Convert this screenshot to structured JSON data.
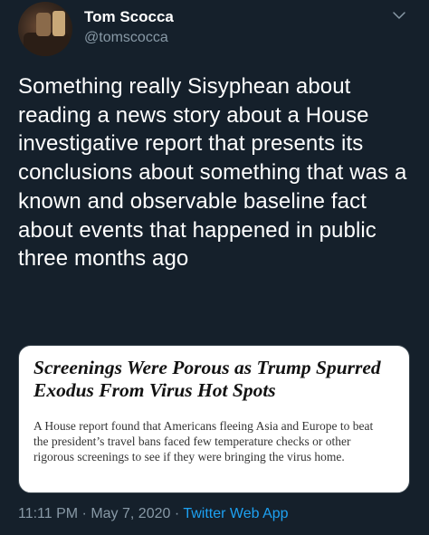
{
  "author": {
    "name": "Tom Scocca",
    "handle": "@tomscocca"
  },
  "tweet": {
    "text": "Something really Sisyphean about reading a news story about a House investigative report that presents its conclusions about something that was a known and observable baseline fact about events that happened in public three months ago"
  },
  "card": {
    "headline": "Screenings Were Porous as Trump Spurred Exodus From Virus Hot Spots",
    "summary": "A House report found that Americans fleeing Asia and Europe to beat the president’s travel bans faced few temperature checks or other rigorous screenings to see if they were bringing the virus home."
  },
  "meta": {
    "time": "11:11 PM",
    "separator1": " · ",
    "date": "May 7, 2020",
    "separator2": " · ",
    "app": "Twitter Web App"
  },
  "icons": {
    "menu": "chevron-down-icon"
  },
  "colors": {
    "background": "#15202b",
    "secondary_text": "#8899a6",
    "link": "#1da1f2",
    "card_border": "#38444d"
  }
}
